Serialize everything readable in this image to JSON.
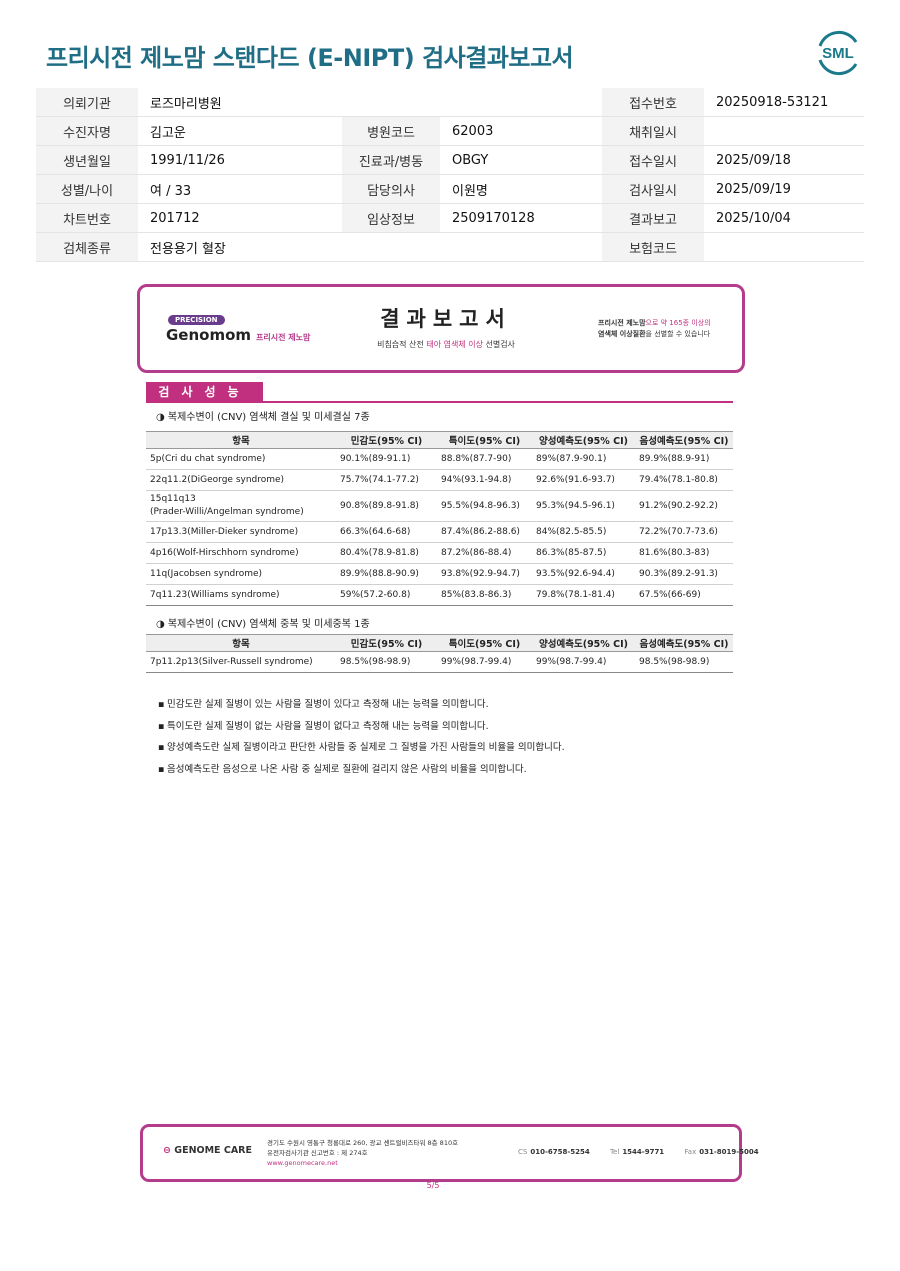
{
  "header": {
    "title": "프리시전 제노맘 스탠다드 (E-NIPT) 검사결과보고서",
    "logo_text": "SML"
  },
  "patient": {
    "r1": {
      "l1": "의뢰기관",
      "v1": "로즈마리병원",
      "l3": "접수번호",
      "v3": "20250918-53121"
    },
    "r2": {
      "l1": "수진자명",
      "v1": "김고운",
      "l2": "병원코드",
      "v2": "62003",
      "l3": "채취일시",
      "v3": ""
    },
    "r3": {
      "l1": "생년월일",
      "v1": "1991/11/26",
      "l2": "진료과/병동",
      "v2": "OBGY",
      "l3": "접수일시",
      "v3": "2025/09/18"
    },
    "r4": {
      "l1": "성별/나이",
      "v1": "여 / 33",
      "l2": "담당의사",
      "v2": "이원명",
      "l3": "검사일시",
      "v3": "2025/09/19"
    },
    "r5": {
      "l1": "차트번호",
      "v1": "201712",
      "l2": "임상정보",
      "v2": "2509170128",
      "l3": "결과보고",
      "v3": "2025/10/04"
    },
    "r6": {
      "l1": "검체종류",
      "v1": "전용용기 혈장",
      "l3": "보험코드",
      "v3": ""
    }
  },
  "report_card": {
    "badge": "PRECISION",
    "brand": "Genomom",
    "brand_kr": "프리시전 제노맘",
    "title": "결과보고서",
    "subtitle_pre": "비침습적 산전 ",
    "subtitle_hl": "태아 염색체 이상",
    "subtitle_post": " 선별검사",
    "right_line1_a": "프리시전 제노맘",
    "right_line1_b": "으로 약 165종 이상의",
    "right_line2_a": "염색체 이상질환",
    "right_line2_b": "을 선별할 수 있습니다"
  },
  "performance": {
    "heading": "검사성능",
    "section1": "◑ 복제수변이 (CNV) 염색체 결실 및 미세결실 7종",
    "section2": "◑ 복제수변이 (CNV) 염색체 중복 및 미세중복 1종",
    "columns": [
      "항목",
      "민감도(95% CI)",
      "특이도(95% CI)",
      "양성예측도(95% CI)",
      "음성예측도(95% CI)"
    ],
    "table1": [
      [
        "5p(Cri du chat syndrome)",
        "90.1%(89-91.1)",
        "88.8%(87.7-90)",
        "89%(87.9-90.1)",
        "89.9%(88.9-91)"
      ],
      [
        "22q11.2(DiGeorge syndrome)",
        "75.7%(74.1-77.2)",
        "94%(93.1-94.8)",
        "92.6%(91.6-93.7)",
        "79.4%(78.1-80.8)"
      ],
      [
        "15q11q13",
        "90.8%(89.8-91.8)",
        "95.5%(94.8-96.3)",
        "95.3%(94.5-96.1)",
        "91.2%(90.2-92.2)"
      ],
      [
        "17p13.3(Miller-Dieker syndrome)",
        "66.3%(64.6-68)",
        "87.4%(86.2-88.6)",
        "84%(82.5-85.5)",
        "72.2%(70.7-73.6)"
      ],
      [
        "4p16(Wolf-Hirschhorn syndrome)",
        "80.4%(78.9-81.8)",
        "87.2%(86-88.4)",
        "86.3%(85-87.5)",
        "81.6%(80.3-83)"
      ],
      [
        "11q(Jacobsen syndrome)",
        "89.9%(88.8-90.9)",
        "93.8%(92.9-94.7)",
        "93.5%(92.6-94.4)",
        "90.3%(89.2-91.3)"
      ],
      [
        "7q11.23(Williams syndrome)",
        "59%(57.2-60.8)",
        "85%(83.8-86.3)",
        "79.8%(78.1-81.4)",
        "67.5%(66-69)"
      ]
    ],
    "row3_line2": "(Prader-Willi/Angelman syndrome)",
    "table2": [
      [
        "7p11.2p13(Silver-Russell syndrome)",
        "98.5%(98-98.9)",
        "99%(98.7-99.4)",
        "99%(98.7-99.4)",
        "98.5%(98-98.9)"
      ]
    ]
  },
  "notes": [
    "민감도란 실제 질병이 있는 사람을 질병이 있다고 측정해 내는 능력을 의미합니다.",
    "특이도란 실제 질병이 없는 사람을 질병이 없다고 측정해 내는 능력을 의미합니다.",
    "양성예측도란 실제 질병이라고 판단한 사람들 중 실제로 그 질병을 가진 사람들의 비율을 의미합니다.",
    "음성예측도란 음성으로 나온 사람 중 실제로 질환에 걸리지 않은 사람의 비율을 의미합니다."
  ],
  "footer": {
    "brand": "GENOME CARE",
    "address1": "경기도 수원시 영통구 청룡대로 260, 광교 센트럴비즈타워 8층 810호",
    "address2": "유전자검사기관 신고번호 : 제 274호",
    "website": "www.genomecare.net",
    "cs_label": "CS",
    "cs": "010-6758-5254",
    "tel_label": "Tel",
    "tel": "1544-9771",
    "fax_label": "Fax",
    "fax": "031-8019-5004",
    "page": "5/5"
  },
  "colors": {
    "title": "#1f6e86",
    "accent": "#c0307f",
    "logo": "#1a7a8a"
  }
}
